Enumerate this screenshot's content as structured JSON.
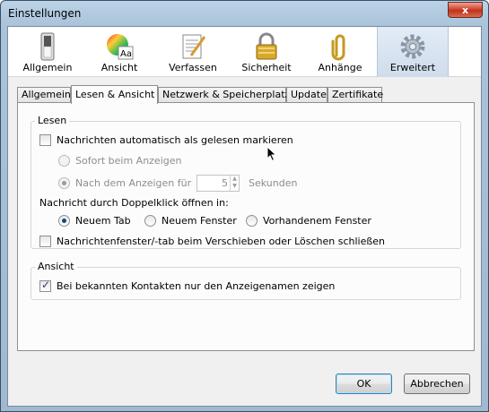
{
  "window": {
    "title": "Einstellungen",
    "close_label": "x"
  },
  "toolbar": [
    {
      "label": "Allgemein",
      "icon": "light-switch-icon"
    },
    {
      "label": "Ansicht",
      "icon": "color-wheel-icon"
    },
    {
      "label": "Verfassen",
      "icon": "notepad-pen-icon"
    },
    {
      "label": "Sicherheit",
      "icon": "padlock-icon"
    },
    {
      "label": "Anhänge",
      "icon": "paperclip-icon"
    },
    {
      "label": "Erweitert",
      "icon": "gear-icon"
    }
  ],
  "tabs": [
    {
      "label": "Allgemein"
    },
    {
      "label": "Lesen & Ansicht"
    },
    {
      "label": "Netzwerk & Speicherplatz"
    },
    {
      "label": "Update"
    },
    {
      "label": "Zertifikate"
    }
  ],
  "lesen": {
    "legend": "Lesen",
    "auto_mark": {
      "label": "Nachrichten automatisch als gelesen markieren",
      "checked": false
    },
    "sofort": {
      "label": "Sofort beim Anzeigen",
      "checked": false,
      "disabled": true
    },
    "nach": {
      "label": "Nach dem Anzeigen für",
      "checked": true,
      "disabled": true
    },
    "seconds_value": "5",
    "seconds_unit": "Sekunden",
    "doubleclick_label": "Nachricht durch Doppelklick öffnen in:",
    "open_options": [
      {
        "label": "Neuem Tab",
        "checked": true
      },
      {
        "label": "Neuem Fenster",
        "checked": false
      },
      {
        "label": "Vorhandenem Fenster",
        "checked": false
      }
    ],
    "close_on_move": {
      "label": "Nachrichtenfenster/-tab beim Verschieben oder Löschen schließen",
      "checked": false
    }
  },
  "ansicht": {
    "legend": "Ansicht",
    "display_names": {
      "label": "Bei bekannten Kontakten nur den Anzeigenamen zeigen",
      "checked": true
    }
  },
  "buttons": {
    "ok": "OK",
    "cancel": "Abbrechen"
  }
}
